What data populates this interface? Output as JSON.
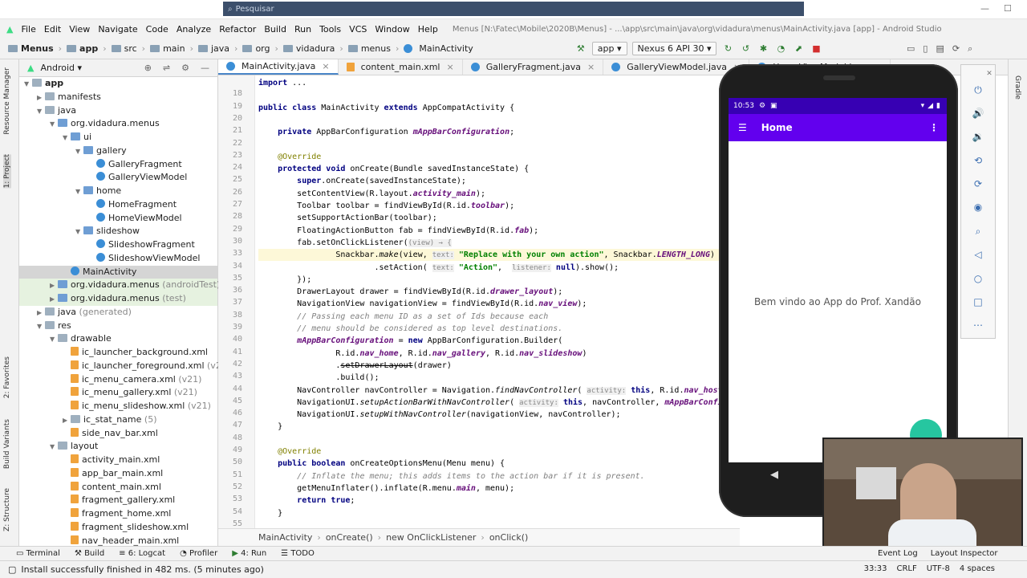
{
  "window": {
    "search_placeholder": "Pesquisar"
  },
  "menubar": {
    "items": [
      "File",
      "Edit",
      "View",
      "Navigate",
      "Code",
      "Analyze",
      "Refactor",
      "Build",
      "Run",
      "Tools",
      "VCS",
      "Window",
      "Help"
    ],
    "project_title": "Menus [N:\\Fatec\\Mobile\\2020B\\Menus] - ...\\app\\src\\main\\java\\org\\vidadura\\menus\\MainActivity.java [app] - Android Studio"
  },
  "navbar": {
    "crumbs": [
      "Menus",
      "app",
      "src",
      "main",
      "java",
      "org",
      "vidadura",
      "menus",
      "MainActivity"
    ],
    "run_config": "app",
    "device": "Nexus 6 API 30"
  },
  "left_strip": {
    "labels": [
      "Resource Manager",
      "1: Project",
      "2: Favorites",
      "Build Variants",
      "Z: Structure"
    ]
  },
  "project_panel": {
    "view_mode": "Android",
    "tree": [
      {
        "label": "app",
        "indent": 0,
        "icon": "f",
        "bold": true,
        "arrow": "▼"
      },
      {
        "label": "manifests",
        "indent": 1,
        "icon": "f",
        "arrow": "▶"
      },
      {
        "label": "java",
        "indent": 1,
        "icon": "f",
        "arrow": "▼"
      },
      {
        "label": "org.vidadura.menus",
        "indent": 2,
        "icon": "fb",
        "arrow": "▼"
      },
      {
        "label": "ui",
        "indent": 3,
        "icon": "fb",
        "arrow": "▼"
      },
      {
        "label": "gallery",
        "indent": 4,
        "icon": "fb",
        "arrow": "▼"
      },
      {
        "label": "GalleryFragment",
        "indent": 5,
        "icon": "c"
      },
      {
        "label": "GalleryViewModel",
        "indent": 5,
        "icon": "c"
      },
      {
        "label": "home",
        "indent": 4,
        "icon": "fb",
        "arrow": "▼"
      },
      {
        "label": "HomeFragment",
        "indent": 5,
        "icon": "c"
      },
      {
        "label": "HomeViewModel",
        "indent": 5,
        "icon": "c"
      },
      {
        "label": "slideshow",
        "indent": 4,
        "icon": "fb",
        "arrow": "▼"
      },
      {
        "label": "SlideshowFragment",
        "indent": 5,
        "icon": "c"
      },
      {
        "label": "SlideshowViewModel",
        "indent": 5,
        "icon": "c"
      },
      {
        "label": "MainActivity",
        "indent": 3,
        "icon": "c",
        "sel": true
      },
      {
        "label": "org.vidadura.menus",
        "suffix": "(androidTest)",
        "indent": 2,
        "icon": "fb",
        "arrow": "▶",
        "green": true
      },
      {
        "label": "org.vidadura.menus",
        "suffix": "(test)",
        "indent": 2,
        "icon": "fb",
        "arrow": "▶",
        "green": true
      },
      {
        "label": "java",
        "suffix": "(generated)",
        "indent": 1,
        "icon": "f",
        "arrow": "▶"
      },
      {
        "label": "res",
        "indent": 1,
        "icon": "f",
        "arrow": "▼"
      },
      {
        "label": "drawable",
        "indent": 2,
        "icon": "f",
        "arrow": "▼"
      },
      {
        "label": "ic_launcher_background.xml",
        "indent": 3,
        "icon": "x"
      },
      {
        "label": "ic_launcher_foreground.xml",
        "suffix": "(v24)",
        "indent": 3,
        "icon": "x"
      },
      {
        "label": "ic_menu_camera.xml",
        "suffix": "(v21)",
        "indent": 3,
        "icon": "x"
      },
      {
        "label": "ic_menu_gallery.xml",
        "suffix": "(v21)",
        "indent": 3,
        "icon": "x"
      },
      {
        "label": "ic_menu_slideshow.xml",
        "suffix": "(v21)",
        "indent": 3,
        "icon": "x"
      },
      {
        "label": "ic_stat_name",
        "suffix": "(5)",
        "indent": 3,
        "icon": "f",
        "arrow": "▶"
      },
      {
        "label": "side_nav_bar.xml",
        "indent": 3,
        "icon": "x"
      },
      {
        "label": "layout",
        "indent": 2,
        "icon": "f",
        "arrow": "▼"
      },
      {
        "label": "activity_main.xml",
        "indent": 3,
        "icon": "x"
      },
      {
        "label": "app_bar_main.xml",
        "indent": 3,
        "icon": "x"
      },
      {
        "label": "content_main.xml",
        "indent": 3,
        "icon": "x"
      },
      {
        "label": "fragment_gallery.xml",
        "indent": 3,
        "icon": "x"
      },
      {
        "label": "fragment_home.xml",
        "indent": 3,
        "icon": "x"
      },
      {
        "label": "fragment_slideshow.xml",
        "indent": 3,
        "icon": "x"
      },
      {
        "label": "nav_header_main.xml",
        "indent": 3,
        "icon": "x"
      }
    ]
  },
  "editor": {
    "tabs": [
      {
        "label": "MainActivity.java",
        "active": true
      },
      {
        "label": "content_main.xml"
      },
      {
        "label": "GalleryFragment.java"
      },
      {
        "label": "GalleryViewModel.java"
      },
      {
        "label": "HomeViewModel.java"
      }
    ],
    "lines": [
      {
        "n": "",
        "html": "<span class='kw'>import</span> ..."
      },
      {
        "n": "18",
        "html": ""
      },
      {
        "n": "19",
        "html": "<span class='kw'>public class</span> MainActivity <span class='kw'>extends</span> AppCompatActivity {"
      },
      {
        "n": "20",
        "html": ""
      },
      {
        "n": "21",
        "html": "    <span class='kw'>private</span> AppBarConfiguration <span class='fi'>mAppBarConfiguration</span>;"
      },
      {
        "n": "22",
        "html": ""
      },
      {
        "n": "23",
        "html": "    <span class='an'>@Override</span>"
      },
      {
        "n": "24",
        "html": "    <span class='kw'>protected void</span> onCreate(Bundle savedInstanceState) {"
      },
      {
        "n": "25",
        "html": "        <span class='kw'>super</span>.onCreate(savedInstanceState);"
      },
      {
        "n": "26",
        "html": "        setContentView(R.layout.<span class='fi'>activity_main</span>);"
      },
      {
        "n": "27",
        "html": "        Toolbar toolbar = findViewById(R.id.<span class='fi'>toolbar</span>);"
      },
      {
        "n": "28",
        "html": "        setSupportActionBar(toolbar);"
      },
      {
        "n": "29",
        "html": "        FloatingActionButton fab = findViewById(R.id.<span class='fi'>fab</span>);"
      },
      {
        "n": "30",
        "html": "        fab.setOnClickListener(<span class='ht'>(view) → {</span>"
      },
      {
        "n": "33",
        "html": "                Snackbar.<span class='it'>make</span>(view, <span class='ht'>text:</span> <span class='st'>\"Replace with your own action\"</span>, Snackbar.<span class='fi'>LENGTH_LONG</span>)",
        "hl": true
      },
      {
        "n": "34",
        "html": "                        .setAction( <span class='ht'>text:</span> <span class='st'>\"Action\"</span>,  <span class='ht'>listener:</span> <span class='kw'>null</span>).show();"
      },
      {
        "n": "35",
        "html": "        });"
      },
      {
        "n": "36",
        "html": "        DrawerLayout drawer = findViewById(R.id.<span class='fi'>drawer_layout</span>);"
      },
      {
        "n": "37",
        "html": "        NavigationView navigationView = findViewById(R.id.<span class='fi'>nav_view</span>);"
      },
      {
        "n": "38",
        "html": "        <span class='cm'>// Passing each menu ID as a set of Ids because each</span>"
      },
      {
        "n": "39",
        "html": "        <span class='cm'>// menu should be considered as top level destinations.</span>"
      },
      {
        "n": "40",
        "html": "        <span class='fi'>mAppBarConfiguration</span> = <span class='kw'>new</span> AppBarConfiguration.Builder("
      },
      {
        "n": "41",
        "html": "                R.id.<span class='fi'>nav_home</span>, R.id.<span class='fi'>nav_gallery</span>, R.id.<span class='fi'>nav_slideshow</span>)"
      },
      {
        "n": "42",
        "html": "                .<s>setDrawerLayout</s>(drawer)"
      },
      {
        "n": "43",
        "html": "                .build();"
      },
      {
        "n": "44",
        "html": "        NavController navController = Navigation.<span class='it'>findNavController</span>( <span class='ht'>activity:</span> <span class='kw'>this</span>, R.id.<span class='fi'>nav_host_fr</span>"
      },
      {
        "n": "45",
        "html": "        NavigationUI.<span class='it'>setupActionBarWithNavController</span>( <span class='ht'>activity:</span> <span class='kw'>this</span>, navController, <span class='fi'>mAppBarConfigur</span>"
      },
      {
        "n": "46",
        "html": "        NavigationUI.<span class='it'>setupWithNavController</span>(navigationView, navController);"
      },
      {
        "n": "47",
        "html": "    }"
      },
      {
        "n": "48",
        "html": ""
      },
      {
        "n": "49",
        "html": "    <span class='an'>@Override</span>"
      },
      {
        "n": "50",
        "html": "    <span class='kw'>public boolean</span> onCreateOptionsMenu(Menu menu) {"
      },
      {
        "n": "51",
        "html": "        <span class='cm'>// Inflate the menu; this adds items to the action bar if it is present.</span>"
      },
      {
        "n": "52",
        "html": "        getMenuInflater().inflate(R.menu.<span class='fi'>main</span>, menu);"
      },
      {
        "n": "53",
        "html": "        <span class='kw'>return true</span>;"
      },
      {
        "n": "54",
        "html": "    }"
      },
      {
        "n": "55",
        "html": ""
      }
    ],
    "breadcrumbs": [
      "MainActivity",
      "onCreate()",
      "new OnClickListener",
      "onClick()"
    ]
  },
  "emulator": {
    "status_time": "10:53",
    "toolbar_title": "Home",
    "welcome_text": "Bem vindo ao App do Prof. Xandão",
    "fab_color": "#26c6a0",
    "toolbar_color": "#6200ee",
    "statusbar_color": "#3700b3"
  },
  "bottom_tools": [
    "Terminal",
    "Build",
    "6: Logcat",
    "Profiler",
    "4: Run",
    "TODO"
  ],
  "bottom_tools_right": [
    "Event Log",
    "Layout Inspector"
  ],
  "status": {
    "message": "Install successfully finished in 482 ms. (5 minutes ago)",
    "position": "33:33",
    "line_sep": "CRLF",
    "encoding": "UTF-8",
    "indent": "4 spaces"
  }
}
